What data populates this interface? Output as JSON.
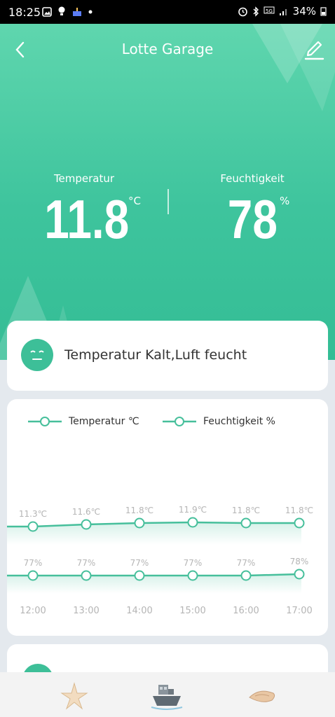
{
  "status_bar": {
    "time": "18:25",
    "battery": "34%"
  },
  "header": {
    "title": "Lotte Garage"
  },
  "readings": {
    "temperature": {
      "label": "Temperatur",
      "value": "11.8",
      "unit": "°C"
    },
    "humidity": {
      "label": "Feuchtigkeit",
      "value": "78",
      "unit": "%"
    }
  },
  "comfort": {
    "text": "Temperatur Kalt,Luft feucht"
  },
  "chart_data": {
    "type": "line",
    "x": [
      "12:00",
      "13:00",
      "14:00",
      "15:00",
      "16:00",
      "17:00"
    ],
    "series": [
      {
        "name": "Temperatur ℃",
        "values": [
          11.3,
          11.6,
          11.8,
          11.9,
          11.8,
          11.8
        ],
        "labels": [
          "11.3℃",
          "11.6℃",
          "11.8℃",
          "11.9℃",
          "11.8℃",
          "11.8℃"
        ]
      },
      {
        "name": "Feuchtigkeit %",
        "values": [
          77,
          77,
          77,
          77,
          77,
          78
        ],
        "labels": [
          "77%",
          "77%",
          "77%",
          "77%",
          "77%",
          "78%"
        ]
      }
    ],
    "colors": {
      "line": "#46bf9b"
    },
    "grid": false,
    "legend": "top-left"
  },
  "tabs": [
    {
      "icon": "starfish-icon"
    },
    {
      "icon": "boat-icon"
    },
    {
      "icon": "shell-icon"
    }
  ]
}
